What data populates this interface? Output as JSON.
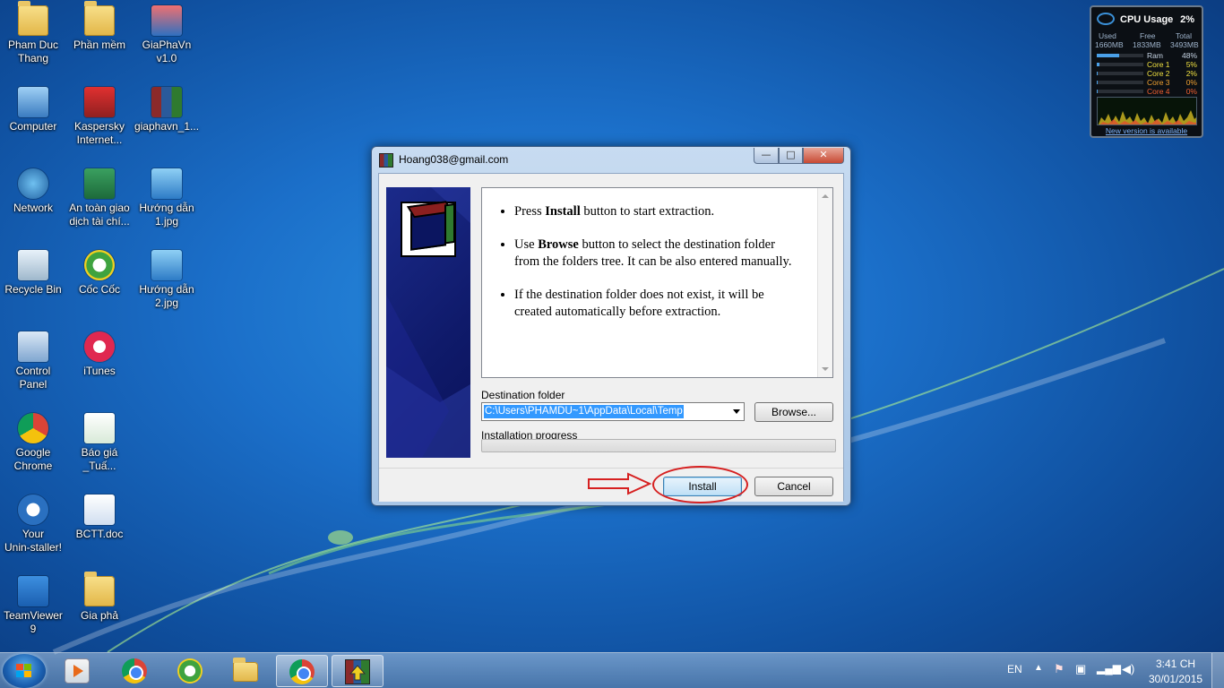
{
  "desktop": {
    "icons": [
      {
        "label": "Pham Duc\nThang",
        "icon": "user-folder-icon"
      },
      {
        "label": "Phần mềm",
        "icon": "folder-icon"
      },
      {
        "label": "GiaPhaVn\nv1.0",
        "icon": "people-icon"
      },
      {
        "label": "Computer",
        "icon": "computer-icon"
      },
      {
        "label": "Kaspersky\nInternet...",
        "icon": "kaspersky-icon"
      },
      {
        "label": "giaphavn_1...",
        "icon": "winrar-icon"
      },
      {
        "label": "Network",
        "icon": "network-icon"
      },
      {
        "label": "An toàn giao\ndịch tài chí...",
        "icon": "green-app-icon"
      },
      {
        "label": "Hướng dẫn\n1.jpg",
        "icon": "image-file-icon"
      },
      {
        "label": "Recycle Bin",
        "icon": "recycle-bin-icon"
      },
      {
        "label": "Cốc Cốc",
        "icon": "coccoc-icon"
      },
      {
        "label": "Hướng dẫn\n2.jpg",
        "icon": "image-file-icon"
      },
      {
        "label": "Control\nPanel",
        "icon": "control-panel-icon"
      },
      {
        "label": "iTunes",
        "icon": "itunes-icon"
      },
      {
        "label": "Google\nChrome",
        "icon": "chrome-icon"
      },
      {
        "label": "Báo giá\n_Tuấ...",
        "icon": "excel-file-icon"
      },
      {
        "label": "Your\nUnin-staller!",
        "icon": "uninstaller-icon"
      },
      {
        "label": "BCTT.doc",
        "icon": "word-file-icon"
      },
      {
        "label": "TeamViewer\n9",
        "icon": "teamviewer-icon"
      },
      {
        "label": "Gia phả",
        "icon": "folder-icon"
      }
    ]
  },
  "dialog": {
    "title": "Hoang038@gmail.com",
    "buttons": {
      "minimize": "—",
      "maximize": "□",
      "close": "✕"
    },
    "instructions": [
      {
        "bold": "Install",
        "pre": "Press ",
        "post": " button to start extraction."
      },
      {
        "bold": "Browse",
        "pre": "Use ",
        "post": " button to select the destination folder from the folders tree. It can be also entered manually."
      },
      {
        "bold": "",
        "pre": "If the destination folder does not exist, it will be created automatically before extraction.",
        "post": ""
      }
    ],
    "destination_label": "Destination folder",
    "destination_value": "C:\\Users\\PHAMDU~1\\AppData\\Local\\Temp",
    "browse_label": "Browse...",
    "progress_label": "Installation progress",
    "progress_value": 0,
    "install_label": "Install",
    "cancel_label": "Cancel"
  },
  "gadget": {
    "title": "CPU Usage",
    "total_pct": "2%",
    "used_label": "Used",
    "used_value": "1660MB",
    "free_label": "Free",
    "free_value": "1833MB",
    "total_label": "Total",
    "total_value": "3493MB",
    "rows": [
      {
        "name": "Ram",
        "value": "48%",
        "level": 0.48,
        "color": "#c8d6e6"
      },
      {
        "name": "Core 1",
        "value": "5%",
        "level": 0.05,
        "color": "#f0e040"
      },
      {
        "name": "Core 2",
        "value": "2%",
        "level": 0.02,
        "color": "#f0e040"
      },
      {
        "name": "Core 3",
        "value": "0%",
        "level": 0.0,
        "color": "#f0a030"
      },
      {
        "name": "Core 4",
        "value": "0%",
        "level": 0.0,
        "color": "#f06030"
      }
    ],
    "link": "New version is available"
  },
  "taskbar": {
    "language": "EN",
    "time": "3:41 CH",
    "date": "30/01/2015",
    "apps": [
      "media-player-icon",
      "chrome-icon",
      "coccoc-icon",
      "explorer-icon",
      "chrome-icon",
      "winrar-icon"
    ]
  },
  "colors": {
    "annotation": "#d62020",
    "selection": "#3399ff"
  }
}
